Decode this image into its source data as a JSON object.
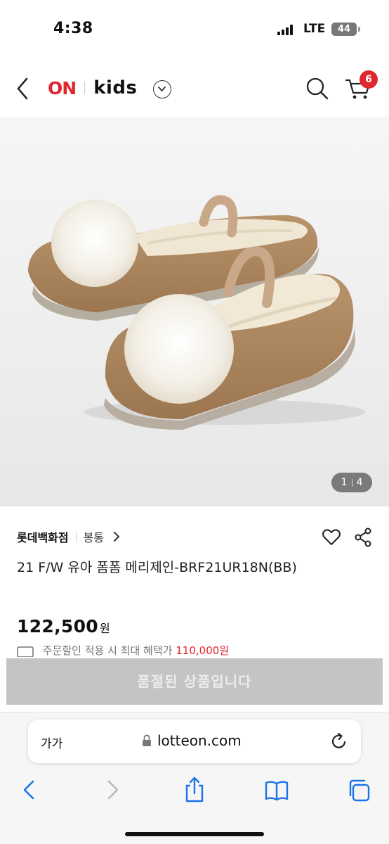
{
  "status_bar": {
    "time": "4:38",
    "network": "LTE",
    "battery": "44"
  },
  "header": {
    "logo_on": "ON",
    "logo_kids": "kids",
    "cart_count": "6"
  },
  "gallery": {
    "current": "1",
    "total": "4"
  },
  "product": {
    "store": "롯데백화점",
    "brand": "봉통",
    "title": "21 F/W 유아 폼폼 메리제인-BRF21UR18N(BB)",
    "price": "122,500",
    "currency": "원",
    "coupon_text": "주문할인 적용 시 최대 혜택가",
    "coupon_price": "110,000원"
  },
  "cta": {
    "label": "품절된 상품입니다"
  },
  "browser": {
    "text_size_label": "가가",
    "url": "lotteon.com"
  },
  "colors": {
    "brand_red": "#e0262f",
    "disabled_gray": "#c4c4c4",
    "ios_blue": "#1a73e8"
  },
  "icons": [
    "back-icon",
    "chevron-down-icon",
    "search-icon",
    "cart-icon",
    "heart-icon",
    "share-icon",
    "lock-icon",
    "reload-icon",
    "safari-back-icon",
    "safari-forward-icon",
    "safari-share-icon",
    "bookmarks-icon",
    "tabs-icon"
  ]
}
